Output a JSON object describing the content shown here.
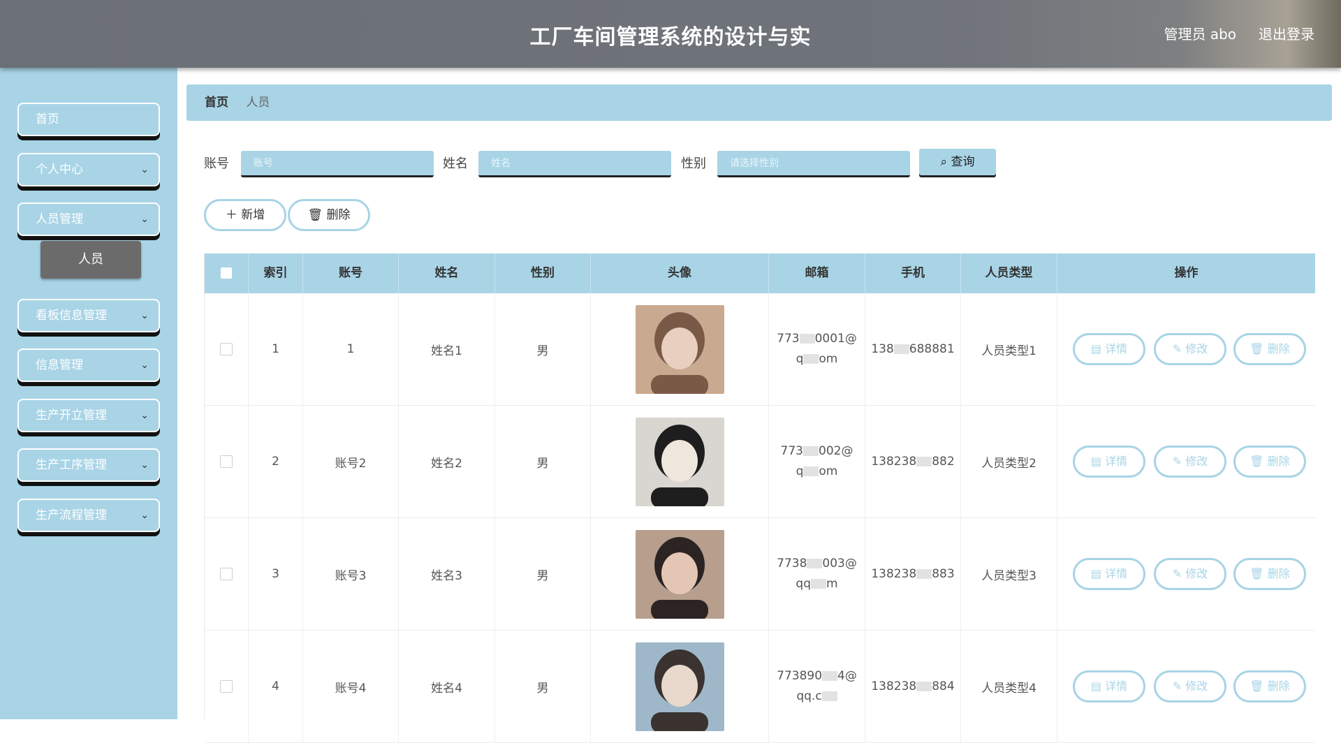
{
  "header": {
    "title": "工厂车间管理系统的设计与实",
    "user": "管理员 abo",
    "logout": "退出登录"
  },
  "sidebar": {
    "items": [
      {
        "label": "首页",
        "chevron": false
      },
      {
        "label": "个人中心",
        "chevron": true
      },
      {
        "label": "人员管理",
        "chevron": true
      },
      {
        "label": "看板信息管理",
        "chevron": true
      },
      {
        "label": "信息管理",
        "chevron": true
      },
      {
        "label": "生产开立管理",
        "chevron": true
      },
      {
        "label": "生产工序管理",
        "chevron": true
      },
      {
        "label": "生产流程管理",
        "chevron": true
      }
    ],
    "submenu": {
      "label": "人员"
    }
  },
  "breadcrumb": {
    "home": "首页",
    "current": "人员"
  },
  "search": {
    "account_label": "账号",
    "account_placeholder": "账号",
    "name_label": "姓名",
    "name_placeholder": "姓名",
    "gender_label": "性别",
    "gender_placeholder": "请选择性别",
    "query_label": "查询"
  },
  "actions": {
    "add_label": "新增",
    "delete_label": "删除"
  },
  "table": {
    "columns": [
      "索引",
      "账号",
      "姓名",
      "性别",
      "头像",
      "邮箱",
      "手机",
      "人员类型",
      "操作"
    ],
    "rows": [
      {
        "index": "1",
        "account": "1",
        "name": "姓名1",
        "gender": "男",
        "email_l1": "773",
        "email_l1b": "0001@",
        "email_l2": "q",
        "email_l2b": "om",
        "phone_a": "138",
        "phone_b": "688881",
        "type": "人员类型1"
      },
      {
        "index": "2",
        "account": "账号2",
        "name": "姓名2",
        "gender": "男",
        "email_l1": "773",
        "email_l1b": "002@",
        "email_l2": "q",
        "email_l2b": "om",
        "phone_a": "138238",
        "phone_b": "882",
        "type": "人员类型2"
      },
      {
        "index": "3",
        "account": "账号3",
        "name": "姓名3",
        "gender": "男",
        "email_l1": "7738",
        "email_l1b": "003@",
        "email_l2": "qq",
        "email_l2b": "m",
        "phone_a": "138238",
        "phone_b": "883",
        "type": "人员类型3"
      },
      {
        "index": "4",
        "account": "账号4",
        "name": "姓名4",
        "gender": "男",
        "email_l1": "773890",
        "email_l1b": "4@",
        "email_l2": "qq.c",
        "email_l2b": "",
        "phone_a": "138238",
        "phone_b": "884",
        "type": "人员类型4"
      }
    ],
    "row_actions": {
      "detail": "详情",
      "edit": "修改",
      "delete": "删除"
    }
  },
  "colors": {
    "accent": "#a8d4e6",
    "header": "#6f737a",
    "submenu_active": "#6b6b6b"
  },
  "icons": [
    "chevron-down-icon",
    "search-icon",
    "plus-icon",
    "trash-icon",
    "document-icon",
    "pencil-icon"
  ]
}
